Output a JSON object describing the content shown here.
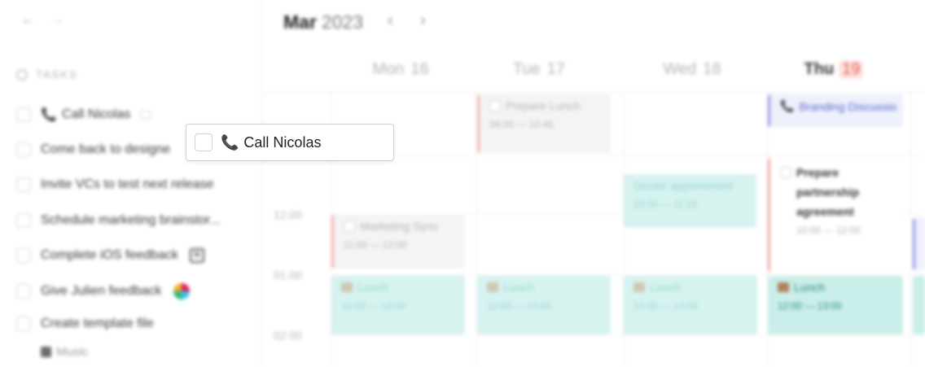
{
  "sidebar": {
    "back_arrow": "←",
    "forward_arrow": "→",
    "tasks_label": "TASKS",
    "tasks": [
      {
        "label": "Call Nicolas",
        "icon": "phone-icon",
        "has_chat": true
      },
      {
        "label": "Come back to designe"
      },
      {
        "label": "Invite VCs to test next release"
      },
      {
        "label": "Schedule marketing brainstor..."
      },
      {
        "label": "Complete iOS feedback",
        "icon_right": "notion-icon"
      },
      {
        "label": "Give Julien feedback",
        "icon_right": "slack-icon"
      },
      {
        "label": "Create template file"
      }
    ],
    "subtask": {
      "label": "Music",
      "icon": "music-icon"
    }
  },
  "calendar": {
    "month": "Mar",
    "year": "2023",
    "prev": "‹",
    "next": "›",
    "days": [
      {
        "name": "Mon",
        "num": "16"
      },
      {
        "name": "Tue",
        "num": "17"
      },
      {
        "name": "Wed",
        "num": "18"
      },
      {
        "name": "Thu",
        "num": "19",
        "today": true
      }
    ],
    "time_labels": [
      "12:00",
      "01:00",
      "02:00"
    ],
    "events": {
      "prepare_lunch": {
        "title": "Prepare Lunch",
        "range": "09:00 — 10:45"
      },
      "branding": {
        "title": "Branding Discussio"
      },
      "doctor": {
        "title": "Doctor appointment",
        "range": "10:30 — 11:15"
      },
      "partnership": {
        "title": "Prepare partnership agreement",
        "range": "10:00 — 12:00"
      },
      "marketing_sync": {
        "title": "Marketing Sync",
        "range": "11:00 — 12:00"
      },
      "lunch_mon": {
        "title": "Lunch",
        "range": "12:00 — 13:00"
      },
      "lunch_tue": {
        "title": "Lunch",
        "range": "12:00 — 13:00"
      },
      "lunch_wed": {
        "title": "Lunch",
        "range": "12:00 — 13:00"
      },
      "lunch_thu": {
        "title": "Lunch",
        "range": "12:00 — 13:00"
      }
    },
    "colors": {
      "today_accent": "#e8554a",
      "lunch_teal": "#caeeea",
      "branding_blue": "#5b66cf"
    }
  },
  "drag_ghost": {
    "label": "Call Nicolas",
    "icon": "phone-icon"
  }
}
